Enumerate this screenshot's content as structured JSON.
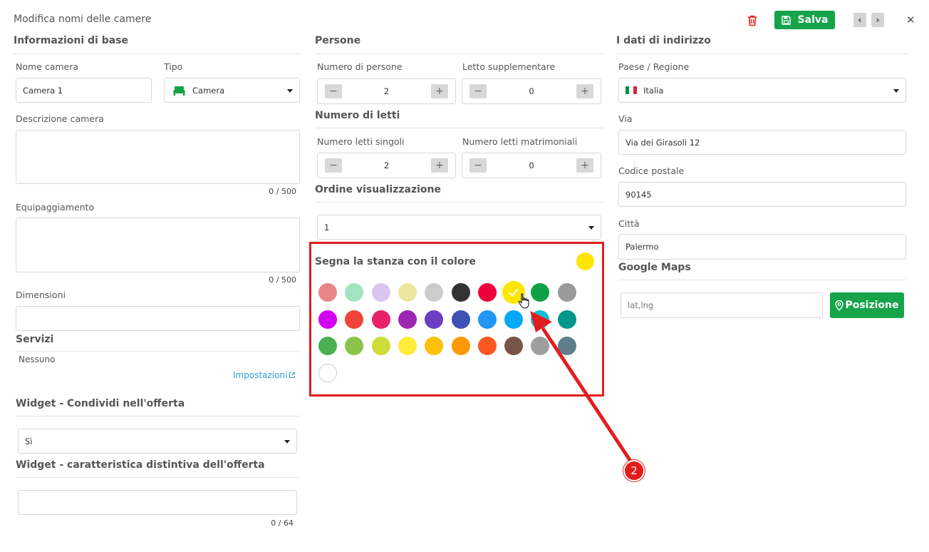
{
  "header": {
    "title": "Modifica nomi delle camere",
    "save_label": "Salva",
    "prev_glyph": "‹",
    "next_glyph": "›",
    "close_glyph": "✕"
  },
  "basic": {
    "section_title": "Informazioni di base",
    "room_name_label": "Nome camera",
    "room_name_value": "Camera 1",
    "type_label": "Tipo",
    "type_value": "Camera",
    "description_label": "Descrizione camera",
    "description_counter": "0 / 500",
    "equipment_label": "Equipaggiamento",
    "equipment_counter": "0 / 500",
    "dimensions_label": "Dimensioni",
    "services_title": "Servizi",
    "services_value": "Nessuno",
    "settings_link": "Impostazioni",
    "widget_share_title": "Widget - Condividi nell'offerta",
    "widget_share_value": "Sì",
    "widget_feature_title": "Widget - caratteristica distintiva dell'offerta",
    "widget_feature_counter": "0 / 64"
  },
  "people": {
    "section_title": "Persone",
    "persons_label": "Numero di persone",
    "persons_value": "2",
    "extra_bed_label": "Letto supplementare",
    "extra_bed_value": "0",
    "beds_title": "Numero di letti",
    "single_beds_label": "Numero letti singoli",
    "single_beds_value": "2",
    "double_beds_label": "Numero letti matrimoniali",
    "double_beds_value": "0",
    "order_title": "Ordine visualizzazione",
    "order_value": "1",
    "minus": "−",
    "plus": "+"
  },
  "color_picker": {
    "title": "Segna la stanza con il colore",
    "selected_color": "#ffe600",
    "colors": [
      "#e88585",
      "#a2e3c2",
      "#d9c6f0",
      "#ece7a0",
      "#cccccc",
      "#333333",
      "#f0003c",
      "#ffe600",
      "#0fa147",
      "#999999",
      "#d200f0",
      "#f04438",
      "#e8216a",
      "#9c27b0",
      "#6c3ec1",
      "#3f51b5",
      "#2196f3",
      "#03a9f4",
      "#14bcd4",
      "#009688",
      "#4caf50",
      "#8bc34a",
      "#cddc39",
      "#ffeb3b",
      "#ffc107",
      "#ff9800",
      "#ff5722",
      "#795548",
      "#9e9e9e",
      "#607d8b",
      "#ffffff"
    ],
    "selected_index": 7
  },
  "annotation": {
    "number": "2",
    "color": "#e31d1d"
  },
  "address": {
    "section_title": "I dati di indirizzo",
    "country_label": "Paese / Regione",
    "country_value": "Italia",
    "street_label": "Via",
    "street_value": "Via dei Girasoli 12",
    "postal_label": "Codice postale",
    "postal_value": "90145",
    "city_label": "Città",
    "city_value": "Palermo",
    "maps_title": "Google Maps",
    "coords_placeholder": "lat,lng",
    "position_button": "Posizione"
  }
}
